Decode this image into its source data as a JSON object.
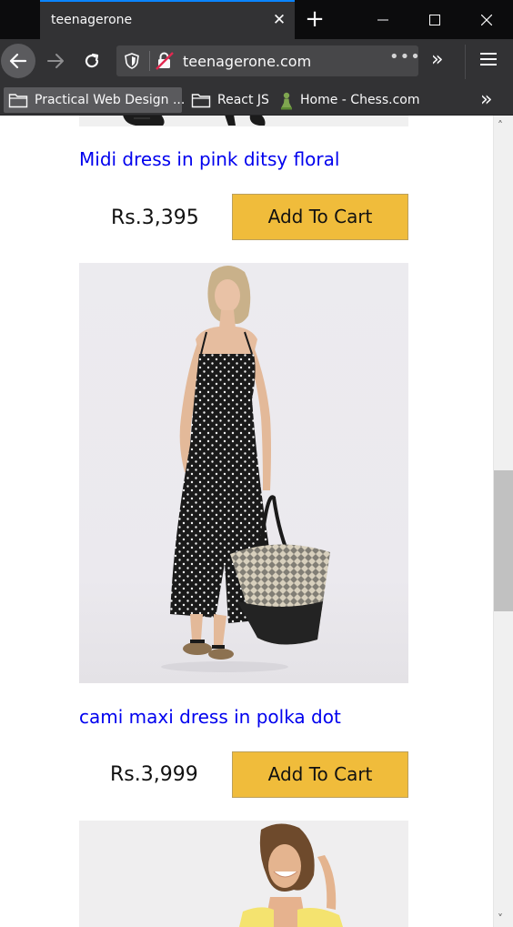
{
  "tab": {
    "title": "teenagerone"
  },
  "nav": {
    "url": "teenagerone.com"
  },
  "bookmarks": [
    {
      "label": "Practical Web Design ..."
    },
    {
      "label": "React JS"
    },
    {
      "label": "Home - Chess.com"
    }
  ],
  "products": [
    {
      "title": "Midi dress in pink ditsy floral",
      "price": "Rs.3,395",
      "button": "Add To Cart"
    },
    {
      "title": "cami maxi dress in polka dot",
      "price": "Rs.3,999",
      "button": "Add To Cart"
    }
  ],
  "icons": {
    "back": "arrow-left-icon",
    "forward": "arrow-right-icon",
    "reload": "reload-icon",
    "shield": "tracking-shield-icon",
    "lock": "insecure-lock-icon",
    "menu": "hamburger-icon",
    "folder": "folder-icon",
    "chess": "chess-pawn-icon"
  },
  "colors": {
    "accent": "#0a84ff",
    "link": "#0000ee",
    "button": "#f0bc3b"
  }
}
